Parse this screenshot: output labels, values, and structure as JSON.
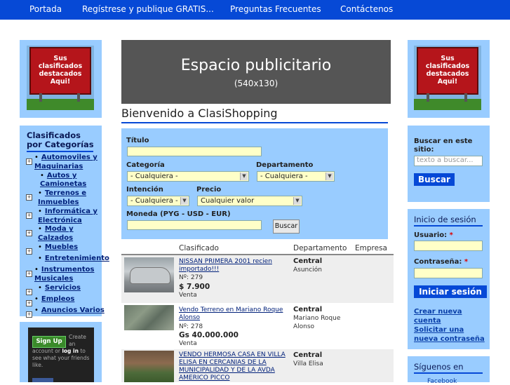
{
  "nav": {
    "items": [
      "Portada",
      "Regístrese y publique GRATIS...",
      "Preguntas Frecuentes",
      "Contáctenos"
    ]
  },
  "billboard": {
    "text": "Sus clasificados destacados Aqui!"
  },
  "categories": {
    "title_line1": "Clasificados",
    "title_line2": "por Categorías",
    "items": [
      {
        "lines": [
          "Automoviles y",
          "Maquinarias"
        ]
      },
      {
        "lines": [
          "Autos y",
          "Camionetas"
        ]
      },
      {
        "lines": [
          "Terrenos e",
          "Inmuebles"
        ]
      },
      {
        "lines": [
          "Informática y",
          "Electrónica"
        ]
      },
      {
        "lines": [
          "Moda y",
          "Calzados"
        ]
      },
      {
        "lines": [
          "Muebles"
        ]
      },
      {
        "lines": [
          "Entretenimiento"
        ]
      },
      {
        "lines": [
          "Instrumentos",
          "Musicales"
        ]
      },
      {
        "lines": [
          "Servicios"
        ]
      },
      {
        "lines": [
          "Empleos"
        ]
      },
      {
        "lines": [
          "Anuncios Varios"
        ]
      }
    ]
  },
  "facebook_widget": {
    "signup": "Sign Up",
    "text_a": "Create",
    "text_b": "an",
    "text_c": "account or",
    "text_login": "log in",
    "text_d": "to",
    "text_e": "see what your friends",
    "text_f": "like."
  },
  "ad": {
    "title": "Espacio publicitario",
    "size": "(540x130)"
  },
  "welcome": "Bienvenido a ClasiShopping",
  "search_form": {
    "titulo_label": "Título",
    "categoria_label": "Categoría",
    "categoria_value": "- Cualquiera -",
    "departamento_label": "Departamento",
    "departamento_value": "- Cualquiera -",
    "intencion_label": "Intención",
    "intencion_value": "- Cualquiera -",
    "precio_label": "Precio",
    "precio_value": "Cualquier valor",
    "moneda_label": "Moneda (PYG - USD - EUR)",
    "submit": "Buscar"
  },
  "table": {
    "headers": [
      "Clasificado",
      "Departamento",
      "Empresa"
    ],
    "rows": [
      {
        "title": "NISSAN PRIMERA 2001 recien importado!!!",
        "title_lines": [
          "NISSAN PRIMERA 2001 recien",
          "importado!!!"
        ],
        "number": "Nº: 279",
        "price": "$ 7.900",
        "intent": "Venta",
        "department": "Central",
        "city": "Asunción"
      },
      {
        "title": "Vendo Terreno en Mariano Roque Alonso",
        "title_lines": [
          "Vendo Terreno en Mariano Roque",
          "Alonso"
        ],
        "number": "Nº: 278",
        "price": "Gs 40.000.000",
        "intent": "Venta",
        "department": "Central",
        "city": "Mariano Roque Alonso"
      },
      {
        "title": "VENDO HERMOSA CASA EN VILLA ELISA EN CERCANIAS DE LA MUNICIPALIDAD Y DE LA AVDA AMERICO PICCO",
        "title_lines": [
          "VENDO HERMOSA CASA EN VILLA",
          "ELISA EN CERCANIAS DE LA",
          "MUNICIPALIDAD Y DE LA AVDA",
          "AMERICO PICCO"
        ],
        "number": "",
        "price": "",
        "intent": "",
        "department": "Central",
        "city": "Villa Elisa"
      }
    ]
  },
  "right_search": {
    "label": "Buscar en este sitio:",
    "placeholder": "texto a buscar...",
    "button": "Buscar"
  },
  "login": {
    "title": "Inicio de sesión",
    "user_label": "Usuario:",
    "pass_label": "Contraseña:",
    "required_mark": "*",
    "button": "Iniciar sesión",
    "create_account": "Crear nueva cuenta",
    "new_password": "Solicitar una nueva contraseña"
  },
  "follow": {
    "title": "Síguenos en",
    "facebook": "Facebook"
  },
  "colors": {
    "nav": "#0649d6",
    "panel": "#99ccff",
    "link": "#00207a"
  }
}
